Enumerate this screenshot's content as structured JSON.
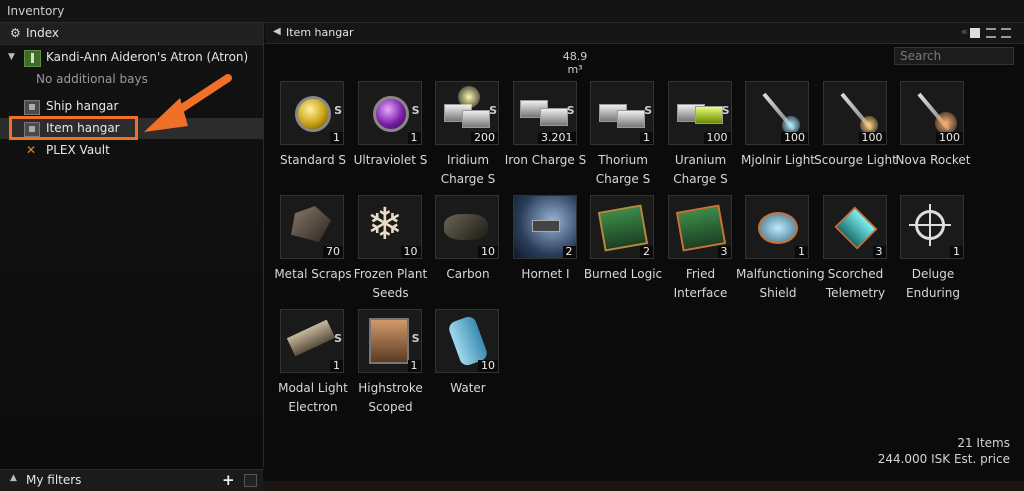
{
  "window": {
    "title": "Inventory"
  },
  "left": {
    "index_label": "Index",
    "ship_name": "Kandi-Ann Aideron's Atron (Atron)",
    "no_bays": "No additional bays",
    "ship_hangar": "Ship hangar",
    "item_hangar": "Item hangar",
    "plex_vault": "PLEX Vault",
    "filters_label": "My filters"
  },
  "right": {
    "header": "Item hangar",
    "volume": "48.9 m³",
    "search_placeholder": "Search"
  },
  "items": [
    {
      "name": "Standard S",
      "qty": "1",
      "size": "S"
    },
    {
      "name": "Ultraviolet S",
      "qty": "1",
      "size": "S"
    },
    {
      "name": "Iridium Charge S",
      "qty": "200",
      "size": "S"
    },
    {
      "name": "Iron Charge S",
      "qty": "3.201",
      "size": "S"
    },
    {
      "name": "Thorium Charge S",
      "qty": "1",
      "size": "S"
    },
    {
      "name": "Uranium Charge S",
      "qty": "100",
      "size": "S"
    },
    {
      "name": "Mjolnir Light",
      "qty": "100",
      "size": ""
    },
    {
      "name": "Scourge Light",
      "qty": "100",
      "size": ""
    },
    {
      "name": "Nova Rocket",
      "qty": "100",
      "size": ""
    },
    {
      "name": "Metal Scraps",
      "qty": "70",
      "size": ""
    },
    {
      "name": "Frozen Plant Seeds",
      "qty": "10",
      "size": ""
    },
    {
      "name": "Carbon",
      "qty": "10",
      "size": ""
    },
    {
      "name": "Hornet I",
      "qty": "2",
      "size": ""
    },
    {
      "name": "Burned Logic",
      "qty": "2",
      "size": ""
    },
    {
      "name": "Fried Interface",
      "qty": "3",
      "size": ""
    },
    {
      "name": "Malfunctioning Shield",
      "qty": "1",
      "size": ""
    },
    {
      "name": "Scorched Telemetry",
      "qty": "3",
      "size": ""
    },
    {
      "name": "Deluge Enduring",
      "qty": "1",
      "size": ""
    },
    {
      "name": "Modal Light Electron",
      "qty": "1",
      "size": "S"
    },
    {
      "name": "Highstroke Scoped",
      "qty": "1",
      "size": "S"
    },
    {
      "name": "Water",
      "qty": "10",
      "size": ""
    }
  ],
  "footer": {
    "count": "21 Items",
    "price": "244.000 ISK Est. price"
  }
}
